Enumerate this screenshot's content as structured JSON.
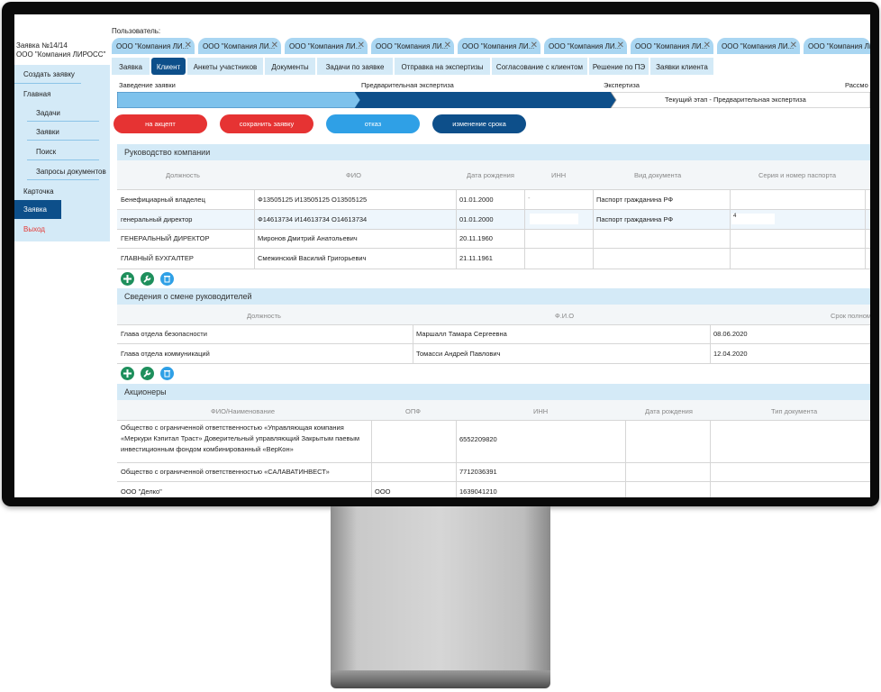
{
  "app": {
    "request_title": "Заявка №14/14",
    "request_company": "ООО \"Компания ЛИРОСС\"",
    "user_label": "Пользователь:"
  },
  "sidebar": {
    "items": [
      {
        "label": "Создать заявку"
      },
      {
        "label": "Главная"
      },
      {
        "label": "Задачи"
      },
      {
        "label": "Заявки"
      },
      {
        "label": "Поиск"
      },
      {
        "label": "Запросы документов"
      },
      {
        "label": "Карточка"
      },
      {
        "label": "Заявка"
      },
      {
        "label": "Выход"
      }
    ],
    "exit_color": "#e53935",
    "active_color": "#0d4f8a"
  },
  "tabs": [
    {
      "label": "ООО \"Компания ЛИ..."
    },
    {
      "label": "ООО \"Компания ЛИ..."
    },
    {
      "label": "ООО \"Компания ЛИ..."
    },
    {
      "label": "ООО \"Компания ЛИ..."
    },
    {
      "label": "ООО \"Компания ЛИ..."
    },
    {
      "label": "ООО \"Компания ЛИ..."
    },
    {
      "label": "ООО \"Компания ЛИ..."
    },
    {
      "label": "ООО \"Компания ЛИ..."
    },
    {
      "label": "ООО \"Компания ЛИ..."
    }
  ],
  "subnav": [
    {
      "label": "Заявка"
    },
    {
      "label": "Клиент"
    },
    {
      "label": "Анкеты участников"
    },
    {
      "label": "Документы"
    },
    {
      "label": "Задачи по заявке"
    },
    {
      "label": "Отправка на экспертизы"
    },
    {
      "label": "Согласование с клиентом"
    },
    {
      "label": "Решение по ПЭ"
    },
    {
      "label": "Заявки клиента"
    }
  ],
  "stages": {
    "labels": [
      "Заведение заявки",
      "Предварительная экспертиза",
      "Экспертиза",
      "Рассмо"
    ],
    "current": "Текущий этап - Предварительная экспертиза"
  },
  "buttons": {
    "accept": "на акцепт",
    "save": "сохранить заявку",
    "reject": "отказ",
    "change_term": "изменение срока"
  },
  "management": {
    "title": "Руководство компании",
    "headers": [
      "Должность",
      "ФИО",
      "Дата рождения",
      "ИНН",
      "Вид документа",
      "Серия и номер паспорта"
    ],
    "rows": [
      {
        "position": "Бенефициарный владелец",
        "name": "Ф13505125 И13505125 О13505125",
        "birth": "01.01.2000",
        "inn": "-",
        "doc": "Паспорт гражданина РФ",
        "passport": ""
      },
      {
        "position": "генеральный директор",
        "name": "Ф14613734 И14613734 О14613734",
        "birth": "01.01.2000",
        "inn": "",
        "doc": "Паспорт гражданина РФ",
        "passport": "4"
      },
      {
        "position": "ГЕНЕРАЛЬНЫЙ ДИРЕКТОР",
        "name": "Миронов Дмитрий Анатольевич",
        "birth": "20.11.1960",
        "inn": "",
        "doc": "",
        "passport": ""
      },
      {
        "position": "ГЛАВНЫЙ БУХГАЛТЕР",
        "name": "Смежинский Василий Григорьевич",
        "birth": "21.11.1961",
        "inn": "",
        "doc": "",
        "passport": ""
      }
    ]
  },
  "changes": {
    "title": "Сведения о смене руководителей",
    "headers": [
      "Должность",
      "Ф.И.О",
      "Срок полном"
    ],
    "rows": [
      {
        "position": "Глава отдела безопасности",
        "name": "Маршалл Тамара Сергеевна",
        "term": "08.06.2020"
      },
      {
        "position": "Глава отдела коммуникаций",
        "name": "Томасси Андрей Павлович",
        "term": "12.04.2020"
      }
    ]
  },
  "shareholders": {
    "title": "Акционеры",
    "headers": [
      "ФИО/Наименование",
      "ОПФ",
      "ИНН",
      "Дата рождения",
      "Тип документа"
    ],
    "rows": [
      {
        "name": "Общество с ограниченной ответственностью «Управляющая компания «Меркури Кэпитал Траст» Доверительный управляющий Закрытым паевым инвестиционным фондом комбинированный «ВерКон»",
        "opf": "",
        "inn": "6552209820",
        "birth": "",
        "doc": ""
      },
      {
        "name": "Общество с ограниченной ответственностью «САЛАВАТИНВЕСТ»",
        "opf": "",
        "inn": "7712036391",
        "birth": "",
        "doc": ""
      },
      {
        "name": "ООО \"Делко\"",
        "opf": "ООО",
        "inn": "1639041210",
        "birth": "",
        "doc": ""
      }
    ]
  },
  "icons": [
    "add-icon",
    "wrench-icon",
    "trash-icon"
  ]
}
